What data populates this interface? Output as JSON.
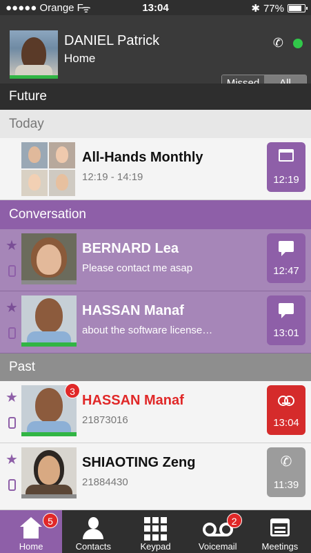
{
  "status_bar": {
    "carrier": "●●●●● Orange F",
    "wifi": "ᯤ",
    "time": "13:04",
    "bluetooth": "✱",
    "battery": "77%"
  },
  "header": {
    "name": "DANIEL Patrick",
    "location": "Home",
    "filter": {
      "missed": "Missed",
      "all": "All",
      "selected": "All"
    }
  },
  "sections": {
    "future": "Future",
    "today": "Today",
    "conversation": "Conversation",
    "past": "Past"
  },
  "rows": [
    {
      "title": "All-Hands Monthly",
      "subtitle": "12:19 - 14:19",
      "time": "12:19",
      "icon": "calendar-icon"
    },
    {
      "title": "BERNARD Lea",
      "subtitle": "Please contact me asap",
      "time": "12:47",
      "icon": "chat-icon"
    },
    {
      "title": "HASSAN Manaf",
      "subtitle": "about the software license…",
      "time": "13:01",
      "icon": "chat-icon"
    },
    {
      "title": "HASSAN Manaf",
      "subtitle": "21873016",
      "time": "13:04",
      "icon": "voicemail-icon",
      "badge": "3"
    },
    {
      "title": "SHIAOTING Zeng",
      "subtitle": "21884430",
      "time": "11:39",
      "icon": "phone-icon"
    }
  ],
  "tabs": [
    {
      "label": "Home",
      "badge": "5",
      "icon": "home-icon"
    },
    {
      "label": "Contacts",
      "icon": "contact-icon"
    },
    {
      "label": "Keypad",
      "icon": "keypad-icon"
    },
    {
      "label": "Voicemail",
      "badge": "2",
      "icon": "voicemail-icon"
    },
    {
      "label": "Meetings",
      "icon": "calendar-icon"
    }
  ],
  "colors": {
    "accent": "#8e5fa8",
    "presence_green": "#31b544",
    "alert_red": "#d52b2b"
  }
}
